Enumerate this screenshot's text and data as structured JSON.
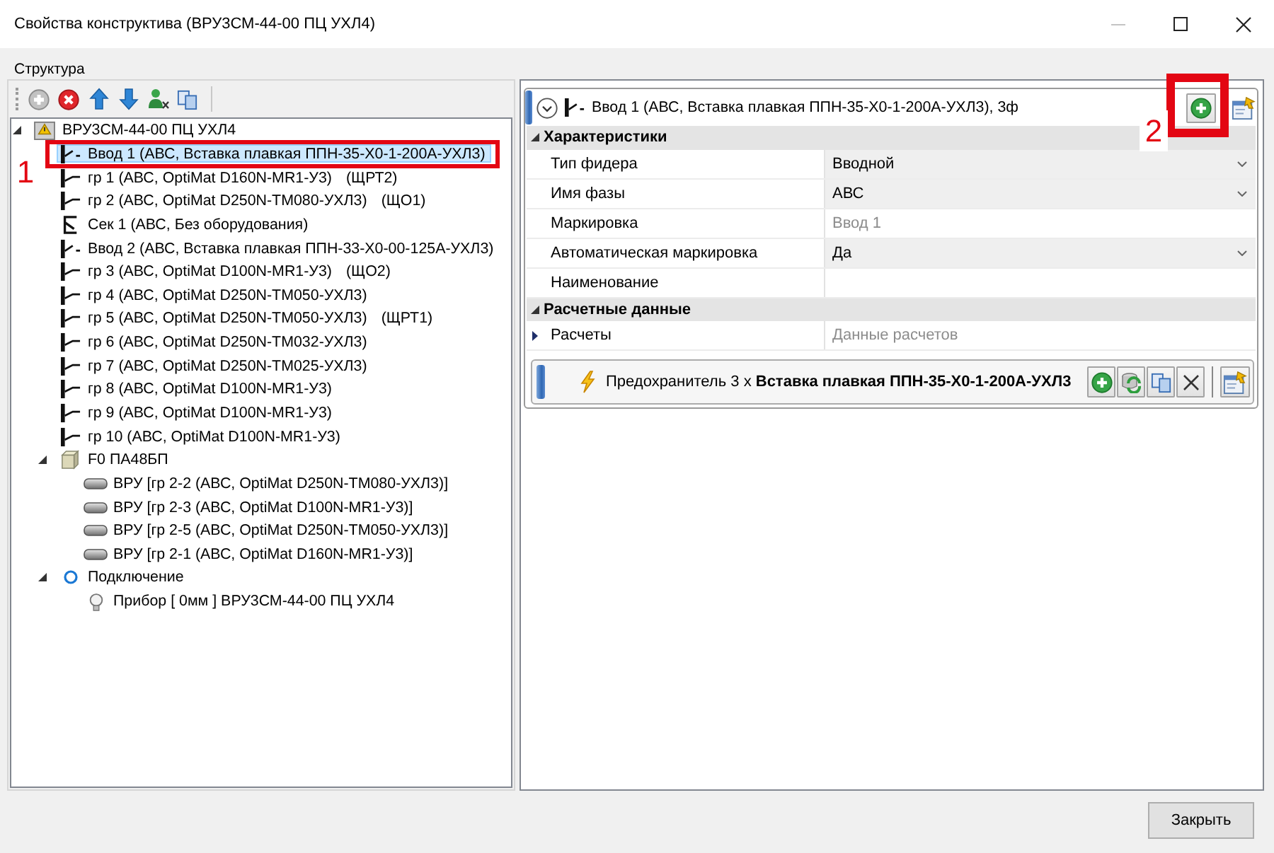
{
  "window": {
    "title": "Свойства конструктива (ВРУ3СМ-44-00 ПЦ УХЛ4)",
    "minimize_disabled": true
  },
  "structure": {
    "label": "Структура",
    "toolbar": [
      {
        "kind": "add",
        "disabled": true
      },
      {
        "kind": "delete",
        "disabled": false
      },
      {
        "kind": "move_up",
        "disabled": false
      },
      {
        "kind": "move_down",
        "disabled": false
      },
      {
        "kind": "user",
        "disabled": false
      },
      {
        "kind": "copy",
        "disabled": false
      }
    ],
    "tree": [
      {
        "kind": "root",
        "label": "ВРУ3СМ-44-00 ПЦ УХЛ4",
        "selected": false,
        "expanded": true,
        "children": [
          {
            "kind": "input",
            "label": "Ввод 1 (АВС, Вставка плавкая ППН-35-Х0-1-200А-УХЛ3)",
            "selected": true
          },
          {
            "kind": "feeder",
            "label": "гр 1 (АВС, OptiMat D160N-MR1-У3)",
            "tag": "(ЩРТ2)",
            "selected": false
          },
          {
            "kind": "feeder",
            "label": "гр 2 (АВС, OptiMat D250N-TM080-УХЛ3)",
            "tag": "(ЩО1)",
            "selected": false
          },
          {
            "kind": "section",
            "label": "Сек 1 (АВС, Без оборудования)",
            "selected": false
          },
          {
            "kind": "input",
            "label": "Ввод 2 (АВС, Вставка плавкая ППН-33-Х0-00-125А-УХЛ3)",
            "selected": false
          },
          {
            "kind": "feeder",
            "label": "гр 3 (АВС, OptiMat D100N-MR1-У3)",
            "tag": "(ЩО2)",
            "selected": false
          },
          {
            "kind": "feeder",
            "label": "гр 4 (АВС, OptiMat D250N-TM050-УХЛ3)",
            "selected": false
          },
          {
            "kind": "feeder",
            "label": "гр 5 (АВС, OptiMat D250N-TM050-УХЛ3)",
            "tag": "(ЩРТ1)",
            "selected": false
          },
          {
            "kind": "feeder",
            "label": "гр 6 (АВС, OptiMat D250N-TM032-УХЛ3)",
            "selected": false
          },
          {
            "kind": "feeder",
            "label": "гр 7 (АВС, OptiMat D250N-TM025-УХЛ3)",
            "selected": false
          },
          {
            "kind": "feeder",
            "label": "гр 8 (АВС, OptiMat D100N-MR1-У3)",
            "selected": false
          },
          {
            "kind": "feeder",
            "label": "гр 9 (АВС, OptiMat D100N-MR1-У3)",
            "selected": false
          },
          {
            "kind": "feeder",
            "label": "гр 10 (АВС, OptiMat D100N-MR1-У3)",
            "selected": false
          },
          {
            "kind": "cabinet",
            "label": "F0 ПА48БП",
            "selected": false,
            "expanded": true,
            "children": [
              {
                "kind": "device",
                "label": "ВРУ [гр 2-2 (АВС, OptiMat D250N-TM080-УХЛ3)]",
                "selected": false
              },
              {
                "kind": "device",
                "label": "ВРУ [гр 2-3 (АВС, OptiMat D100N-MR1-У3)]",
                "selected": false
              },
              {
                "kind": "device",
                "label": "ВРУ [гр 2-5 (АВС, OptiMat D250N-TM050-УХЛ3)]",
                "selected": false
              },
              {
                "kind": "device",
                "label": "ВРУ [гр 2-1 (АВС, OptiMat D160N-MR1-У3)]",
                "selected": false
              }
            ]
          },
          {
            "kind": "connection",
            "label": "Подключение",
            "selected": false,
            "expanded": true,
            "children": [
              {
                "kind": "instrument",
                "label": "Прибор [ 0мм ] ВРУ3СМ-44-00 ПЦ УХЛ4",
                "selected": false
              }
            ]
          }
        ]
      }
    ]
  },
  "element": {
    "title": "Ввод 1 (АВС, Вставка плавкая ППН-35-Х0-1-200А-УХЛ3), 3ф",
    "categories": [
      {
        "name": "Характеристики",
        "expanded": true,
        "rows": [
          {
            "name": "Тип фидера",
            "kind": "dropdown",
            "value": "Вводной",
            "disabled": false
          },
          {
            "name": "Имя фазы",
            "kind": "dropdown",
            "value": "АВС",
            "disabled": false
          },
          {
            "name": "Маркировка",
            "kind": "text",
            "value": "Ввод 1",
            "disabled": true
          },
          {
            "name": "Автоматическая маркировка",
            "kind": "dropdown",
            "value": "Да",
            "disabled": false
          },
          {
            "name": "Наименование",
            "kind": "text",
            "disabled": false
          }
        ]
      },
      {
        "name": "Расчетные данные",
        "expanded": true,
        "rows": [
          {
            "name": "Расчеты",
            "kind": "text",
            "value": "Данные расчетов",
            "disabled": true,
            "expanded": false
          }
        ]
      }
    ],
    "component": {
      "text": "Предохранитель 3 х **Вставка плавкая ППН-35-Х0-1-200А-УХЛ3**"
    }
  },
  "annotations": [
    {
      "label": "1"
    },
    {
      "label": "2"
    }
  ],
  "footer": {
    "close_button": "Закрыть"
  }
}
